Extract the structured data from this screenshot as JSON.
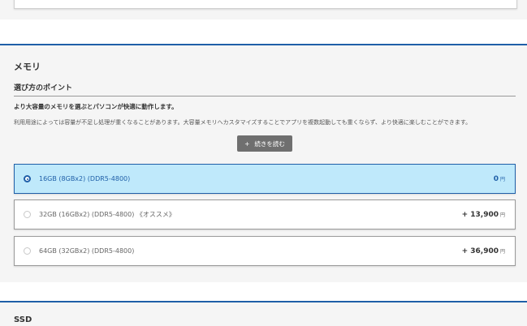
{
  "memory": {
    "title": "メモリ",
    "subheading": "選び方のポイント",
    "desc_bold": "より大容量のメモリを選ぶとパソコンが快適に動作します。",
    "desc_text": "利用用途によっては容量が不足し処理が重くなることがあります。大容量メモリへカスタマイズすることでアプリを複数起動しても重くならず、より快適に楽しむことができます。",
    "read_more": {
      "icon": "+",
      "label": "続きを読む"
    },
    "options": [
      {
        "label": "16GB (8GBx2) (DDR5-4800)",
        "price": "0",
        "unit": "円",
        "selected": true
      },
      {
        "label": "32GB (16GBx2) (DDR5-4800) 《オススメ》",
        "price": "+ 13,900",
        "unit": "円",
        "selected": false
      },
      {
        "label": "64GB (32GBx2) (DDR5-4800)",
        "price": "+ 36,900",
        "unit": "円",
        "selected": false
      }
    ]
  },
  "ssd": {
    "title": "SSD"
  },
  "colors": {
    "accent": "#1f5fa8",
    "selected_bg": "#bfe9fb",
    "button": "#6f6f6f"
  }
}
